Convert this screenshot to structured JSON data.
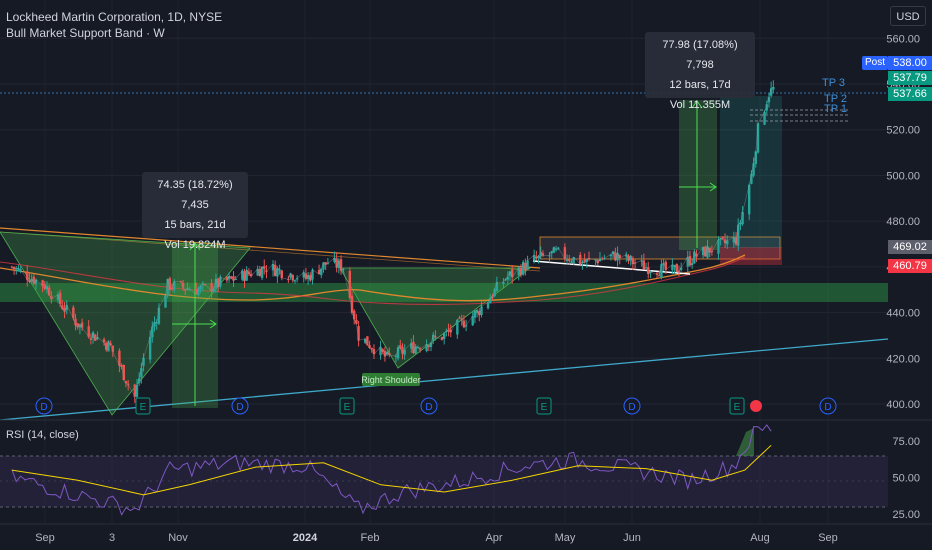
{
  "header": {
    "title": "Lockheed Martin Corporation, 1D, NYSE",
    "indicator": "Bull Market Support Band · W",
    "rsi_label": "RSI (14, close)",
    "currency": "USD"
  },
  "measure_boxes": [
    {
      "line1": "74.35 (18.72%) 7,435",
      "line2": "15 bars, 21d",
      "line3": "Vol 19.824M"
    },
    {
      "line1": "77.98 (17.08%) 7,798",
      "line2": "12 bars, 17d",
      "line3": "Vol 11.355M"
    }
  ],
  "price_tags": {
    "post_label": "Post",
    "post_price": "538.00",
    "last_price": "537.79",
    "line_price": "537.66",
    "level_1": "469.02",
    "level_2": "460.79"
  },
  "targets": {
    "tp3": "TP 3",
    "tp2": "TP 2",
    "tp1": "TP 1"
  },
  "annotation": {
    "right_shoulder": "Right Shoulder"
  },
  "event_markers": {
    "dividend": "D",
    "earnings": "E"
  },
  "chart_data": [
    {
      "type": "line",
      "subtype": "candlestick",
      "ylim": [
        393,
        568
      ],
      "y_ticks": [
        "560.00",
        "540.00",
        "520.00",
        "500.00",
        "480.00",
        "460.00",
        "440.00",
        "420.00",
        "400.00"
      ],
      "x_ticks": [
        "Sep",
        "3",
        "Nov",
        "2024",
        "Feb",
        "Apr",
        "May",
        "Jun",
        "Aug",
        "Sep"
      ],
      "grid": true,
      "series": [
        {
          "description": "daily close",
          "x": [
            "2023-08-21",
            "2023-09-05",
            "2023-09-20",
            "2023-10-05",
            "2023-10-16",
            "2023-10-20",
            "2023-10-24",
            "2023-10-31",
            "2023-11-15",
            "2023-12-01",
            "2023-12-15",
            "2024-01-02",
            "2024-01-12",
            "2024-01-19",
            "2024-01-26",
            "2024-02-08",
            "2024-02-20",
            "2024-03-05",
            "2024-03-20",
            "2024-04-02",
            "2024-04-15",
            "2024-04-25",
            "2024-05-08",
            "2024-05-22",
            "2024-06-05",
            "2024-06-17",
            "2024-06-28",
            "2024-07-10",
            "2024-07-16",
            "2024-07-23",
            "2024-07-26",
            "2024-07-29",
            "2024-07-31",
            "2024-08-02"
          ],
          "values": [
            460,
            452,
            435,
            425,
            403,
            420,
            433,
            452,
            450,
            455,
            460,
            455,
            462,
            460,
            430,
            420,
            425,
            430,
            440,
            455,
            463,
            466,
            462,
            465,
            460,
            458,
            465,
            470,
            472,
            500,
            520,
            530,
            536,
            537.79
          ]
        }
      ]
    },
    {
      "type": "line",
      "title": "RSI (14, close)",
      "ylim": [
        18,
        88
      ],
      "y_ticks": [
        "75.00",
        "50.00",
        "25.00"
      ],
      "series": [
        {
          "description": "RSI",
          "x": [
            "2023-08-21",
            "2023-09-20",
            "2023-10-16",
            "2023-11-01",
            "2023-12-01",
            "2024-01-02",
            "2024-01-26",
            "2024-02-15",
            "2024-03-15",
            "2024-04-10",
            "2024-05-01",
            "2024-06-01",
            "2024-06-25",
            "2024-07-15",
            "2024-07-25",
            "2024-08-01"
          ],
          "values": [
            50,
            38,
            28,
            55,
            60,
            58,
            28,
            40,
            48,
            58,
            62,
            55,
            48,
            58,
            82,
            84
          ]
        },
        {
          "description": "RSI moving average",
          "x": [
            "2023-08-21",
            "2023-09-20",
            "2023-10-20",
            "2023-11-10",
            "2023-12-10",
            "2024-01-10",
            "2024-02-05",
            "2024-03-05",
            "2024-04-05",
            "2024-05-05",
            "2024-06-05",
            "2024-07-05",
            "2024-07-20",
            "2024-08-01"
          ],
          "values": [
            55,
            48,
            38,
            45,
            57,
            60,
            45,
            40,
            48,
            58,
            56,
            48,
            55,
            72
          ]
        }
      ]
    }
  ]
}
